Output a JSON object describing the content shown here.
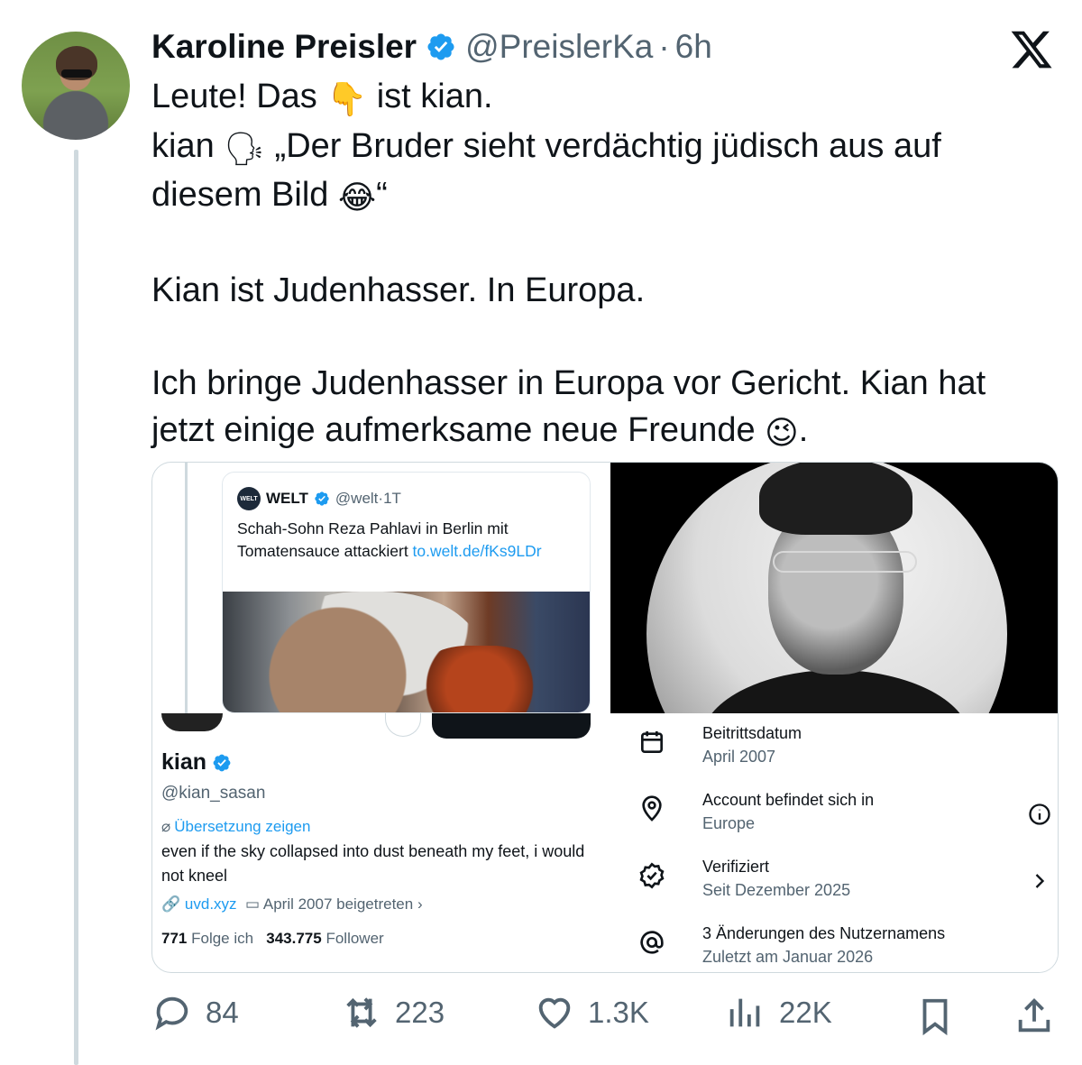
{
  "post": {
    "author_name": "Karoline Preisler",
    "author_handle": "@PreislerKa",
    "separator": "·",
    "time": "6h",
    "lines": [
      {
        "text": "Leute! Das ",
        "emoji": "👇",
        "after": " ist kian."
      },
      {
        "text": "kian ",
        "emoji": "🗣",
        "after": " „Der Bruder sieht verdächtig jüdisch aus auf"
      },
      {
        "text": "diesem Bild ",
        "emoji": "😂",
        "after": "“"
      },
      {
        "text": "Kian ist Judenhasser. In Europa."
      },
      {
        "text": "Ich bringe Judenhasser in Europa vor Gericht. Kian hat"
      },
      {
        "text": "jetzt einige aufmerksame neue Freunde ",
        "emoji": "😉",
        "after": "."
      }
    ]
  },
  "quoted": {
    "logo_text": "WELT",
    "name": "WELT",
    "handle": "@welt",
    "separator": "·",
    "time": "1T",
    "text": "Schah-Sohn Reza Pahlavi in Berlin mit Tomatensauce attackiert ",
    "link": "to.welt.de/fKs9LDr"
  },
  "profile": {
    "name": "kian",
    "handle": "@kian_sasan",
    "translate": "Übersetzung zeigen",
    "bio": "even if the sky collapsed into dust beneath my feet, i would not kneel",
    "website": "uvd.xyz",
    "joined": "April 2007 beigetreten",
    "following_count": "771",
    "following_label": "Folge ich",
    "followers_count": "343.775",
    "followers_label": "Follower"
  },
  "about": [
    {
      "icon": "calendar-icon",
      "title": "Beitrittsdatum",
      "sub": "April 2007"
    },
    {
      "icon": "location-pin-icon",
      "title": "Account befindet sich in",
      "sub": "Europe"
    },
    {
      "icon": "verified-badge-icon",
      "title": "Verifiziert",
      "sub": "Seit Dezember 2025"
    },
    {
      "icon": "at-sign-icon",
      "title": "3 Änderungen des Nutzernamens",
      "sub": "Zuletzt am Januar 2026"
    }
  ],
  "actions": {
    "replies": "84",
    "reposts": "223",
    "likes": "1.3K",
    "views": "22K"
  },
  "colors": {
    "text": "#0f1419",
    "secondary": "#536471",
    "accent": "#1d9bf0",
    "border": "#cfd9de"
  }
}
